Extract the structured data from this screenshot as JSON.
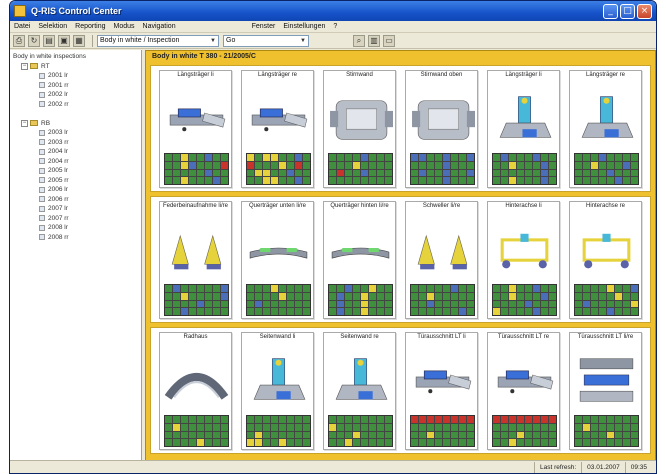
{
  "window": {
    "title": "Q-RIS Control Center",
    "controls": [
      "_",
      "□",
      "×"
    ]
  },
  "menu": [
    "Datei",
    "Selektion",
    "Reporting",
    "Modus",
    "Navigation",
    "",
    "Fenster",
    "Einstellungen",
    "?"
  ],
  "toolbar": {
    "combo_1": "Body in white / Inspection",
    "combo_2": "Go"
  },
  "tree": {
    "rows": [
      {
        "label": "Body in white inspections",
        "kind": "root"
      },
      {
        "label": "RT",
        "kind": "group"
      },
      {
        "label": "2001 lr",
        "kind": "leaf"
      },
      {
        "label": "2001 rr",
        "kind": "leaf"
      },
      {
        "label": "2002 lr",
        "kind": "leaf"
      },
      {
        "label": "2002 rr",
        "kind": "leaf"
      },
      {
        "label": "",
        "kind": "spacer"
      },
      {
        "label": "RB",
        "kind": "group"
      },
      {
        "label": "2003 lr",
        "kind": "leaf"
      },
      {
        "label": "2003 rr",
        "kind": "leaf"
      },
      {
        "label": "2004 lr",
        "kind": "leaf"
      },
      {
        "label": "2004 rr",
        "kind": "leaf"
      },
      {
        "label": "2005 lr",
        "kind": "leaf"
      },
      {
        "label": "2005 rr",
        "kind": "leaf"
      },
      {
        "label": "2006 lr",
        "kind": "leaf"
      },
      {
        "label": "2006 rr",
        "kind": "leaf"
      },
      {
        "label": "2007 lr",
        "kind": "leaf"
      },
      {
        "label": "2007 rr",
        "kind": "leaf"
      },
      {
        "label": "2008 lr",
        "kind": "leaf"
      },
      {
        "label": "2008 rr",
        "kind": "leaf"
      }
    ]
  },
  "main": {
    "header": "Body in white T 380 - 21/2005/C",
    "groups": [
      {
        "cards": [
          {
            "label": "Längsträger li",
            "part": "beam",
            "grid": "ggyggbggggybgggrgggggbggggygggbg"
          },
          {
            "label": "Längsträger re",
            "part": "beam",
            "grid": "ygyyggbgrgggygrggyyggbggggyyggbg"
          },
          {
            "label": "Stirnwand",
            "part": "wall",
            "grid": "ggggbggggggygggggrggbggggggggggg"
          },
          {
            "label": "Stirnwand oben",
            "part": "wall",
            "grid": "bbggbggbggggbggggbggbggbggggbggg"
          },
          {
            "label": "Längsträger li",
            "part": "bracket",
            "grid": "gbgggbggggygggbgggggggbgggygggbg"
          },
          {
            "label": "Längsträger re",
            "part": "bracket",
            "grid": "gggbggggggygggbgggggbggggggggbgg"
          }
        ]
      },
      {
        "cards": [
          {
            "label": "Federbeinaufnahme li/re",
            "part": "pair",
            "grid": "gbgggggbggyggggbggggbgggggbggggg"
          },
          {
            "label": "Querträger unten li/re",
            "part": "rail",
            "grid": "gggyggggggggyggggbgggggggggggggg"
          },
          {
            "label": "Querträger hinten li/re",
            "part": "rail",
            "grid": "ggbggygggbggyggggbggyggggbggyggg"
          },
          {
            "label": "Schweller li/re",
            "part": "pair",
            "grid": "gggggbggggygggggggbgggggggggggbg"
          },
          {
            "label": "Hinterachse li",
            "part": "frame",
            "grid": "ggyggbggggygggbgggggbgggyggggbgg"
          },
          {
            "label": "Hinterachse re",
            "part": "frame",
            "grid": "ggggyggbgggggygggbgggggyggggbggg"
          }
        ]
      },
      {
        "cards": [
          {
            "label": "Radhaus",
            "part": "arch",
            "grid": "gggggggggyggggggggggggggggggyggg"
          },
          {
            "label": "Seitenwand li",
            "part": "bracket",
            "grid": "gggggggggggggggggyggggggyyggyggg"
          },
          {
            "label": "Seitenwand re",
            "part": "bracket",
            "grid": "ggggggggyggggggggggyggggggyggggg"
          },
          {
            "label": "Türausschnitt LT li",
            "part": "beam",
            "grid": "rrrrrrrrggggggggggyggggggggggggg"
          },
          {
            "label": "Türausschnitt LT re",
            "part": "beam",
            "grid": "rrrrrrrrgggggggggggyggggggyggggg"
          },
          {
            "label": "Türausschnitt LT li/re",
            "part": "stack",
            "grid": "gggggggggyggggggggggyggggggggggg"
          }
        ]
      }
    ]
  },
  "status": {
    "left": "Last refresh:",
    "date": "03.01.2007",
    "time": "09:35"
  }
}
